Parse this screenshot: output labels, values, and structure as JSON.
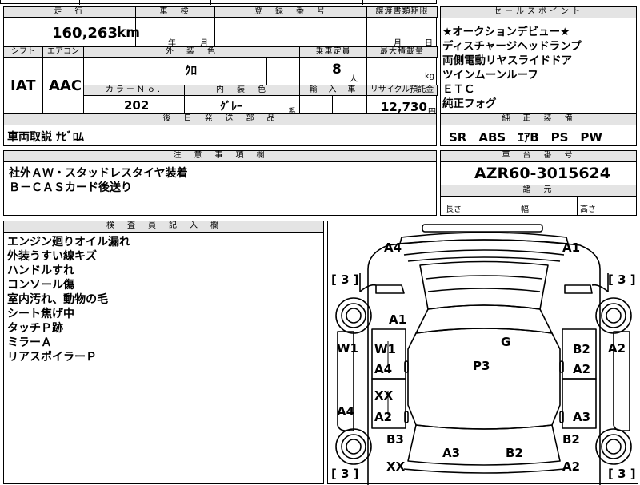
{
  "top_cut": {
    "b1": "",
    "b2": "",
    "b3": "",
    "b4": ""
  },
  "mileage": {
    "header": "走　行",
    "value": "160,263",
    "unit": "km"
  },
  "inspection": {
    "header": "車　検",
    "year_unit": "年",
    "month_unit": "月"
  },
  "registration": {
    "header": "登　録　番　号",
    "value": ""
  },
  "transfer": {
    "header": "譲渡書類期限",
    "month_unit": "月",
    "day_unit": "日"
  },
  "shift": {
    "header": "シフト",
    "value": "IAT"
  },
  "aircon": {
    "header": "エアコン",
    "value": "AAC"
  },
  "exterior_color": {
    "header": "外　装　色",
    "value": "ｸﾛ"
  },
  "capacity": {
    "header": "乗車定員",
    "value": "8",
    "unit": "人"
  },
  "max_load": {
    "header": "最大積載量",
    "unit": "kg"
  },
  "color_no": {
    "header": "カラーＮｏ.",
    "value": "202"
  },
  "interior_color": {
    "header": "内　装　色",
    "value": "ｸﾞﾚｰ",
    "suffix": "系"
  },
  "import": {
    "header": "輸　入　車"
  },
  "recycle": {
    "header": "リサイクル預託金",
    "value": "12,730",
    "unit": "円"
  },
  "later_parts": {
    "header": "後　日　発　送　部　品",
    "value": "車両取説 ﾅﾋﾞﾛﾑ"
  },
  "notes": {
    "header": "注　意　事　項　欄",
    "lines": [
      "社外ＡＷ・スタッドレスタイヤ装着",
      "Ｂ－ＣＡＳカード後送り"
    ]
  },
  "sales_points": {
    "header": "セールスポイント",
    "lines": [
      "★オークションデビュー★",
      "ディスチャージヘッドランプ",
      "両側電動リヤスライドドア",
      "ツインムーンルーフ",
      "ＥＴＣ",
      "純正フォグ"
    ]
  },
  "equipment": {
    "header": "純　正　装　備",
    "value": "SR　ABS　ｴｱB　PS　PW"
  },
  "chassis": {
    "header": "車　台　番　号",
    "value": "AZR60-3015624"
  },
  "dimensions": {
    "header": "諸　元",
    "length": "長さ",
    "width": "幅",
    "height": "高さ"
  },
  "inspector": {
    "header": "検　査　員　記　入　欄",
    "lines": [
      "エンジン廻りオイル漏れ",
      "外装うすい線キズ",
      "ハンドルすれ",
      "コンソール傷",
      "室内汚れ、動物の毛",
      "シート焦げ中",
      "タッチＰ跡",
      "ミラーＡ",
      "リアスポイラーＰ"
    ]
  },
  "diagram": {
    "bracket_left_top": "[ 3 ]",
    "bracket_right_top": "[ 3 ]",
    "bracket_left_bottom": "[ 3 ]",
    "bracket_right_bottom": "[ 3 ]",
    "marks": {
      "front_left_corner": "A4",
      "front_right_corner": "A1",
      "hood": "A1",
      "windshield": "G",
      "roof": "P3",
      "left_fender_outer": "W1",
      "left_fender_w": "W1",
      "left_fender_a": "A4",
      "right_fender_outer": "A2",
      "right_fender_b": "B2",
      "right_fender_a": "A2",
      "left_door_xx": "XX",
      "left_door_a": "A2",
      "left_rocker": "A4",
      "right_door_a": "A3",
      "left_quarter": "B3",
      "right_quarter": "B2",
      "left_rear_xx": "XX",
      "rear_left": "A3",
      "rear_right": "B2",
      "rear_right_corner": "A2"
    }
  }
}
